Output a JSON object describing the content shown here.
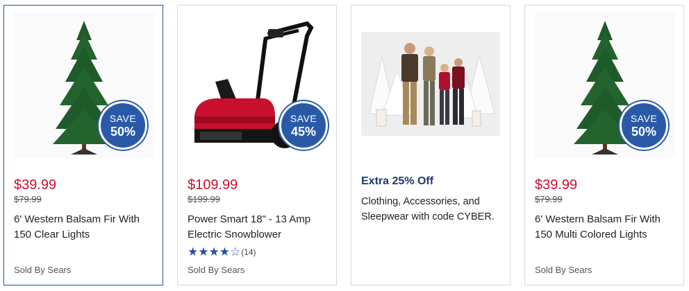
{
  "cards": [
    {
      "badge": {
        "line1": "SAVE",
        "line2": "50%"
      },
      "price": "$39.99",
      "was_price": "$79.99",
      "title": "6' Western Balsam Fir With 150 Clear Lights",
      "seller": "Sold By Sears",
      "image": "christmas-tree-image"
    },
    {
      "badge": {
        "line1": "SAVE",
        "line2": "45%"
      },
      "price": "$109.99",
      "was_price": "$199.99",
      "title": "Power Smart 18\" - 13 Amp Electric Snowblower",
      "rating": {
        "stars": "★★★★☆",
        "value": 4,
        "max": 5,
        "count": "(14)"
      },
      "seller": "Sold By Sears",
      "image": "snowblower-image"
    },
    {
      "heading": "Extra 25% Off",
      "description": "Clothing, Accessories, and Sleepwear with code CYBER.",
      "image": "family-photo-image"
    },
    {
      "badge": {
        "line1": "SAVE",
        "line2": "50%"
      },
      "price": "$39.99",
      "was_price": "$79.99",
      "title": "6' Western Balsam Fir With 150 Multi Colored Lights",
      "seller": "Sold By Sears",
      "image": "christmas-tree-image"
    }
  ],
  "colors": {
    "price_red": "#c8102e",
    "badge_blue": "#2a5aa7",
    "promo_heading": "#1e3a6d",
    "star_blue": "#27509b"
  }
}
